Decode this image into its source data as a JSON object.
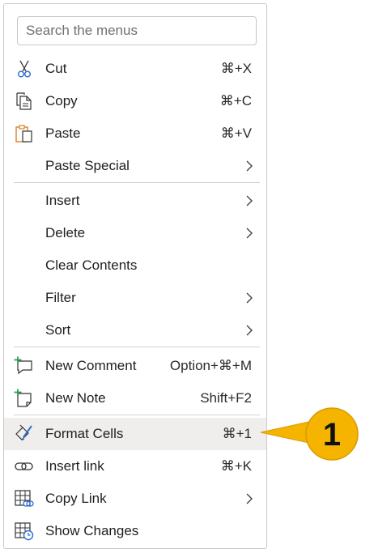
{
  "search": {
    "placeholder": "Search the menus"
  },
  "items": {
    "cut": {
      "label": "Cut",
      "shortcut": "⌘+X",
      "icon": "scissors-icon"
    },
    "copy": {
      "label": "Copy",
      "shortcut": "⌘+C",
      "icon": "copy-icon"
    },
    "paste": {
      "label": "Paste",
      "shortcut": "⌘+V",
      "icon": "paste-icon"
    },
    "paste_special": {
      "label": "Paste Special"
    },
    "insert": {
      "label": "Insert"
    },
    "delete": {
      "label": "Delete"
    },
    "clear_contents": {
      "label": "Clear Contents"
    },
    "filter": {
      "label": "Filter"
    },
    "sort": {
      "label": "Sort"
    },
    "new_comment": {
      "label": "New Comment",
      "shortcut": "Option+⌘+M",
      "icon": "new-comment-icon"
    },
    "new_note": {
      "label": "New Note",
      "shortcut": "Shift+F2",
      "icon": "new-note-icon"
    },
    "format_cells": {
      "label": "Format Cells",
      "shortcut": "⌘+1",
      "icon": "format-cells-icon"
    },
    "insert_link": {
      "label": "Insert link",
      "shortcut": "⌘+K",
      "icon": "link-icon"
    },
    "copy_link": {
      "label": "Copy Link",
      "icon": "copy-link-icon"
    },
    "show_changes": {
      "label": "Show Changes",
      "icon": "show-changes-icon"
    }
  },
  "callout": {
    "number": "1"
  },
  "colors": {
    "accent_green": "#2e9e4f",
    "paste_orange": "#d9822b",
    "link_blue": "#2f6ecf",
    "callout_fill": "#f5b400",
    "highlight": "#efeeed"
  }
}
